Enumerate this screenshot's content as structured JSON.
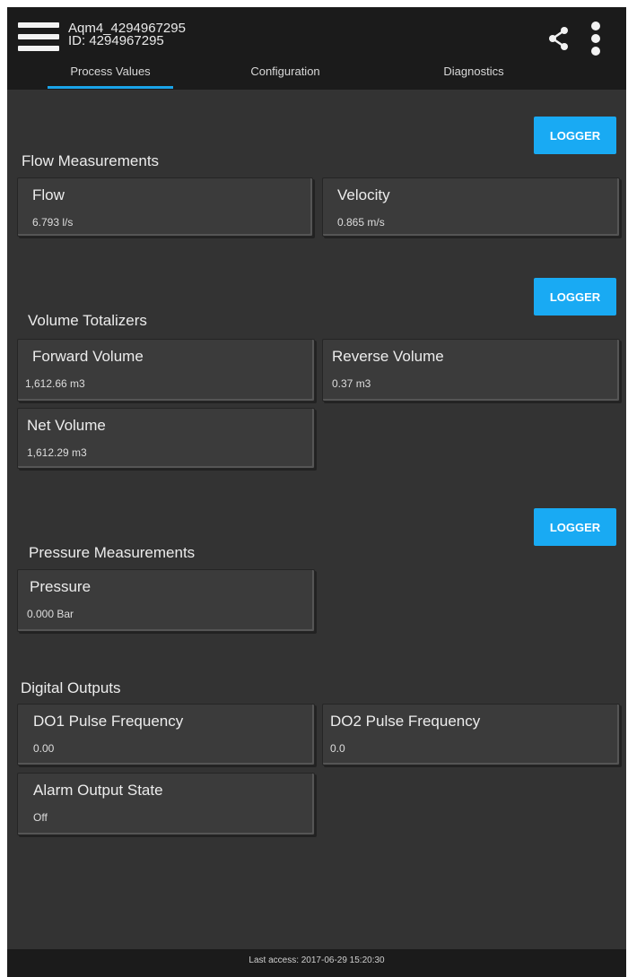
{
  "device": {
    "name": "Aqm4_4294967295",
    "id": "ID: 4294967295"
  },
  "tabs": [
    "Process Values",
    "Configuration",
    "Diagnostics"
  ],
  "logger_label": "LOGGER",
  "sections": {
    "flow": {
      "title": "Flow Measurements",
      "cards": [
        {
          "label": "Flow",
          "value": "6.793 l/s"
        },
        {
          "label": "Velocity",
          "value": "0.865 m/s"
        }
      ]
    },
    "volume": {
      "title": "Volume Totalizers",
      "cards": [
        {
          "label": "Forward Volume",
          "value": "1,612.66 m3"
        },
        {
          "label": "Reverse Volume",
          "value": "0.37 m3"
        },
        {
          "label": "Net Volume",
          "value": "1,612.29 m3"
        }
      ]
    },
    "pressure": {
      "title": "Pressure Measurements",
      "cards": [
        {
          "label": "Pressure",
          "value": "0.000 Bar"
        }
      ]
    },
    "digital": {
      "title": "Digital Outputs",
      "cards": [
        {
          "label": "DO1 Pulse Frequency",
          "value": "0.00"
        },
        {
          "label": "DO2 Pulse Frequency",
          "value": "0.0"
        },
        {
          "label": "Alarm Output State",
          "value": "Off"
        }
      ]
    }
  },
  "footer": {
    "last_access": "Last access: 2017-06-29 15:20:30"
  },
  "colors": {
    "accent": "#19aaf3",
    "background": "#333333",
    "header": "#1b1b1b"
  }
}
